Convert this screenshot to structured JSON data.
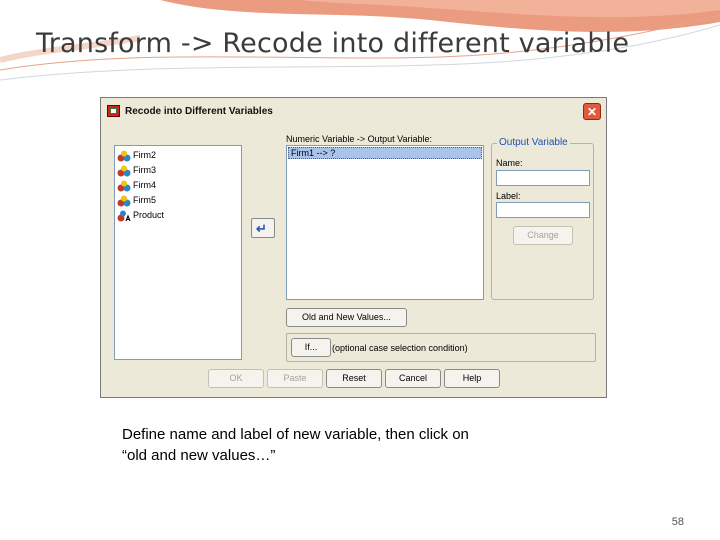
{
  "slide": {
    "title": "Transform -> Recode into different variable",
    "caption_line1": "Define name and label of new variable, then click on",
    "caption_line2": "“old and new values…”",
    "page_number": "58"
  },
  "dialog": {
    "title": "Recode into Different Variables",
    "close_glyph": "✕",
    "source_variables": [
      {
        "label": "Firm2",
        "icon": "scale-variable-icon"
      },
      {
        "label": "Firm3",
        "icon": "scale-variable-icon"
      },
      {
        "label": "Firm4",
        "icon": "scale-variable-icon"
      },
      {
        "label": "Firm5",
        "icon": "scale-variable-icon"
      },
      {
        "label": "Product",
        "icon": "string-variable-icon"
      }
    ],
    "move_glyph": "↵",
    "mapping_label": "Numeric Variable -> Output Variable:",
    "mapping_items": [
      "Firm1  --> ?"
    ],
    "output_group": {
      "title": "Output Variable",
      "name_label": "Name:",
      "name_value": "",
      "label_label": "Label:",
      "label_value": "",
      "change_button": "Change"
    },
    "old_new_button": "Old and New Values...",
    "if_button": "If...",
    "if_text": "(optional case selection condition)",
    "buttons": {
      "ok": "OK",
      "paste": "Paste",
      "reset": "Reset",
      "cancel": "Cancel",
      "help": "Help"
    },
    "colors": {
      "dialog_bg": "#ece9d8",
      "selection": "#a9c3ea",
      "group_title": "#1e50b4",
      "close": "#e25a3c"
    }
  }
}
